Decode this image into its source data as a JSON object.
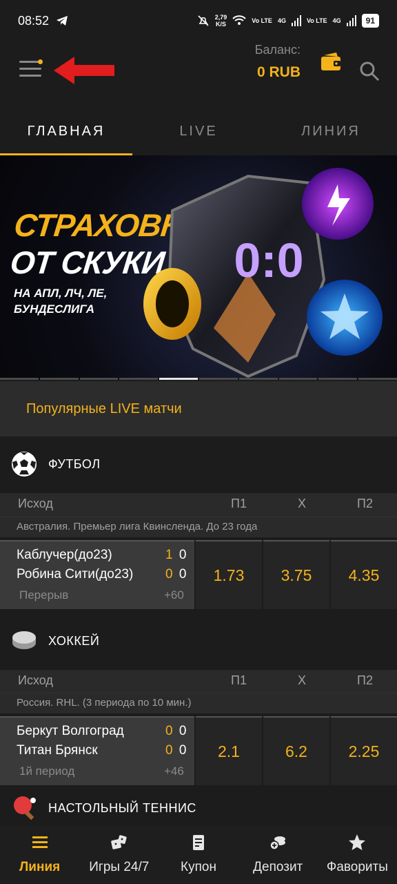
{
  "status": {
    "time": "08:52",
    "speed_value": "2,79",
    "speed_unit": "K/S",
    "net1": "Vo LTE",
    "net2": "4G",
    "battery": "91"
  },
  "header": {
    "balance_label": "Баланс:",
    "balance_value": "0 RUB"
  },
  "tabs": [
    {
      "label": "ГЛАВНАЯ"
    },
    {
      "label": "LIVE"
    },
    {
      "label": "ЛИНИЯ"
    }
  ],
  "banner": {
    "line1": "СТРАХОВКА",
    "line2": "ОТ СКУКИ",
    "sub1": "НА АПЛ, ЛЧ, ЛЕ,",
    "sub2": "БУНДЕСЛИГА",
    "score": "0:0",
    "slide_count": 10,
    "active_slide": 5
  },
  "popular_title": "Популярные LIVE матчи",
  "columns": {
    "outcome": "Исход",
    "p1": "П1",
    "x": "Х",
    "p2": "П2"
  },
  "sports": [
    {
      "name": "ФУТБОЛ",
      "league": "Австралия. Премьер лига Квинсленда. До 23 года",
      "team1": "Каблучер(до23)",
      "team2": "Робина Сити(до23)",
      "score1_a": "1",
      "score1_b": "0",
      "score2_a": "0",
      "score2_b": "0",
      "period": "Перерыв",
      "more": "+60",
      "odds": [
        "1.73",
        "3.75",
        "4.35"
      ]
    },
    {
      "name": "ХОККЕЙ",
      "league": "Россия. RHL. (3 периода по 10 мин.)",
      "team1": "Беркут Волгоград",
      "team2": "Титан Брянск",
      "score1_a": "0",
      "score1_b": "0",
      "score2_a": "0",
      "score2_b": "0",
      "period": "1й период",
      "more": "+46",
      "odds": [
        "2.1",
        "6.2",
        "2.25"
      ]
    },
    {
      "name": "НАСТОЛЬНЫЙ ТЕННИС"
    }
  ],
  "bottom_nav": [
    {
      "label": "Линия",
      "icon": "list-icon"
    },
    {
      "label": "Игры 24/7",
      "icon": "dice-icon"
    },
    {
      "label": "Купон",
      "icon": "coupon-icon"
    },
    {
      "label": "Депозит",
      "icon": "coins-icon"
    },
    {
      "label": "Фавориты",
      "icon": "star-icon"
    }
  ],
  "colors": {
    "accent": "#f4b21b",
    "background": "#1c1c1c",
    "arrow": "#e11d1d"
  }
}
